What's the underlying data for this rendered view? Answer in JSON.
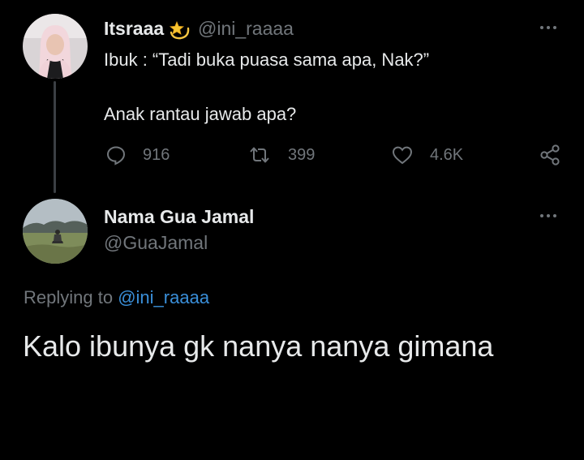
{
  "tweet": {
    "author_name": "Itsraaa",
    "author_emoji": "dizzy-star-emoji",
    "author_handle": "@ini_raaaa",
    "line1": "Ibuk : “Tadi buka puasa sama apa, Nak?”",
    "line2": "Anak rantau jawab apa?",
    "reply_count": "916",
    "retweet_count": "399",
    "like_count": "4.6K",
    "reply_icon": "comment-icon",
    "retweet_icon": "retweet-icon",
    "like_icon": "heart-icon",
    "share_icon": "share-icon"
  },
  "reply": {
    "author_name": "Nama Gua Jamal",
    "author_handle": "@GuaJamal",
    "replying_prefix": "Replying to",
    "replying_to": "@ini_raaaa",
    "text": "Kalo ibunya gk nanya nanya gimana"
  },
  "colors": {
    "background": "#000000",
    "primary_text": "#e7e9ea",
    "secondary_text": "#71767b",
    "link": "#3a8fd9"
  }
}
